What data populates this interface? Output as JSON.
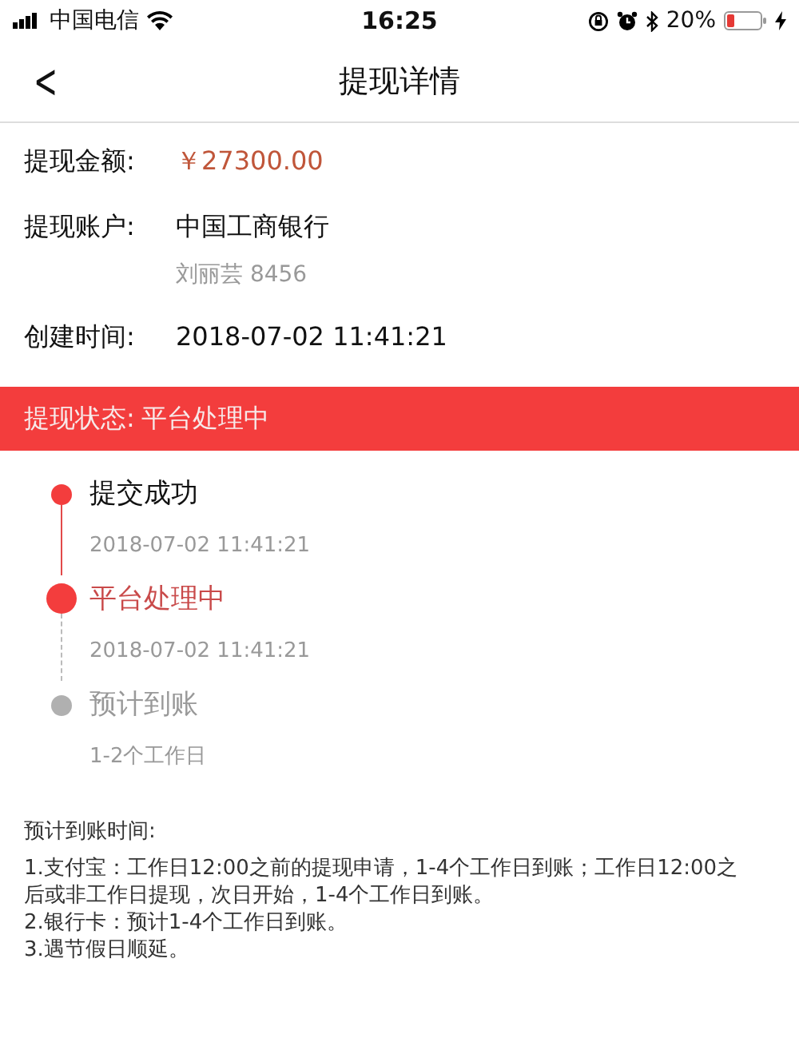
{
  "status_bar": {
    "carrier": "中国电信",
    "time": "16:25",
    "battery": "20%"
  },
  "nav": {
    "back": "<",
    "title": "提现详情"
  },
  "details": [
    {
      "label": "提现金额:",
      "value": "￥27300.00",
      "kind": "amount"
    },
    {
      "label": "提现账户:",
      "value": "中国工商银行",
      "sub": "刘丽芸 8456",
      "kind": "plain"
    },
    {
      "label": "创建时间:",
      "value": "2018-07-02 11:41:21",
      "kind": "plain"
    }
  ],
  "status_banner": {
    "label": "提现状态:",
    "value": "平台处理中"
  },
  "timeline": [
    {
      "title": "提交成功",
      "time": "2018-07-02 11:41:21",
      "kind": "done"
    },
    {
      "title": "平台处理中",
      "time": "2018-07-02 11:41:21",
      "kind": "current"
    },
    {
      "title": "预计到账",
      "time": "1-2个工作日",
      "kind": "pending"
    }
  ],
  "notes": {
    "heading": "预计到账时间:",
    "lines": [
      "1.支付宝：工作日12:00之前的提现申请，1-4个工作日到账；工作日12:00之后或非工作日提现，次日开始，1-4个工作日到账。",
      "2.银行卡：预计1-4个工作日到账。",
      "3.遇节假日顺延。"
    ]
  }
}
